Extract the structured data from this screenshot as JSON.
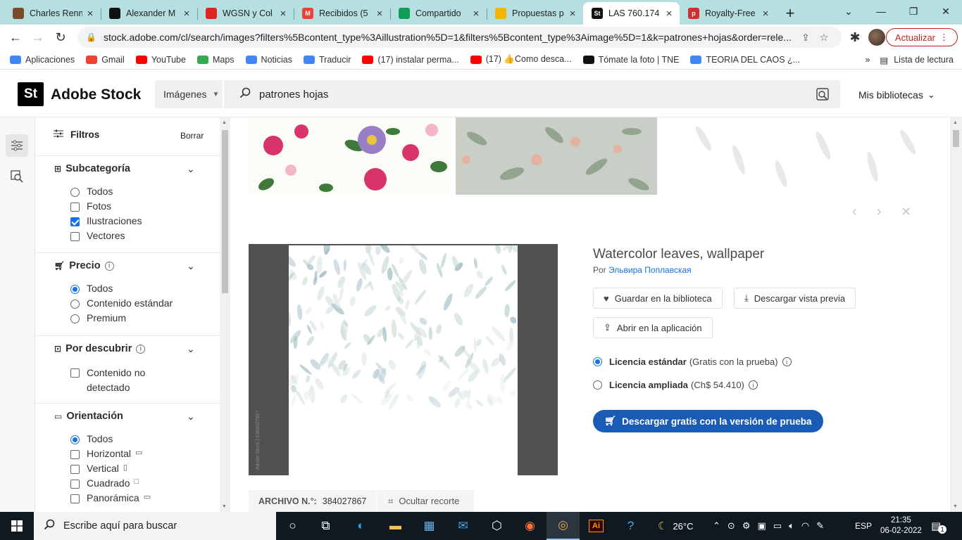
{
  "browser": {
    "tabs": [
      {
        "title": "Charles Renn",
        "fav_text": "",
        "fav_color": "#7a4a2a",
        "active": false
      },
      {
        "title": "Alexander M",
        "fav_text": "",
        "fav_color": "#111111",
        "active": false
      },
      {
        "title": "WGSN y Col",
        "fav_text": "",
        "fav_color": "#e02424",
        "active": false
      },
      {
        "title": "Recibidos (5",
        "fav_text": "M",
        "fav_color": "#ea4335",
        "active": false
      },
      {
        "title": "Compartido",
        "fav_text": "",
        "fav_color": "#0f9d58",
        "active": false
      },
      {
        "title": "Propuestas p",
        "fav_text": "",
        "fav_color": "#f4b400",
        "active": false
      },
      {
        "title": "LAS 760.174",
        "fav_text": "St",
        "fav_color": "#111111",
        "active": true
      },
      {
        "title": "Royalty-Free",
        "fav_text": "p",
        "fav_color": "#d32f2f",
        "active": false
      }
    ],
    "url": "stock.adobe.com/cl/search/images?filters%5Bcontent_type%3Aillustration%5D=1&filters%5Bcontent_type%3Aimage%5D=1&k=patrones+hojas&order=rele...",
    "update_label": "Actualizar",
    "bookmarks": [
      {
        "label": "Aplicaciones",
        "color": "#4285f4"
      },
      {
        "label": "Gmail",
        "color": "#ea4335"
      },
      {
        "label": "YouTube",
        "color": "#ff0000"
      },
      {
        "label": "Maps",
        "color": "#34a853"
      },
      {
        "label": "Noticias",
        "color": "#4285f4"
      },
      {
        "label": "Traducir",
        "color": "#4285f4"
      },
      {
        "label": "(17) instalar perma...",
        "color": "#ff0000"
      },
      {
        "label": "(17) 👍Como desca...",
        "color": "#ff0000"
      },
      {
        "label": "Tómate la foto | TNE",
        "color": "#111111"
      },
      {
        "label": "TEORIA DEL CAOS ¿...",
        "color": "#4285f4"
      }
    ],
    "reading_list": "Lista de lectura"
  },
  "header": {
    "logo_mark": "St",
    "logo_text": "Adobe Stock",
    "type_select": "Imágenes",
    "search_value": "patrones hojas",
    "libraries": "Mis bibliotecas"
  },
  "filters": {
    "title": "Filtros",
    "clear": "Borrar",
    "subcategoria": {
      "title": "Subcategoría",
      "options": [
        "Todos",
        "Fotos",
        "Ilustraciones",
        "Vectores"
      ]
    },
    "precio": {
      "title": "Precio",
      "options": [
        "Todos",
        "Contenido estándar",
        "Premium"
      ]
    },
    "descubrir": {
      "title": "Por descubrir",
      "options": [
        "Contenido no detectado"
      ]
    },
    "orientacion": {
      "title": "Orientación",
      "options": [
        "Todos",
        "Horizontal",
        "Vertical",
        "Cuadrado",
        "Panorámica"
      ]
    }
  },
  "detail": {
    "title": "Watercolor leaves, wallpaper",
    "by_prefix": "Por",
    "author": "Эльвира Поплавская",
    "save_label": "Guardar en la biblioteca",
    "preview_label": "Descargar vista previa",
    "open_app_label": "Abrir en la aplicación",
    "license_std_name": "Licencia estándar",
    "license_std_note": "(Gratis con la prueba)",
    "license_ext_name": "Licencia ampliada",
    "license_ext_note": "(Ch$ 54.410)",
    "cta_label": "Descargar gratis con la versión de prueba",
    "file_label": "ARCHIVO N.°:",
    "file_number": "384027867",
    "crop_label": "Ocultar recorte",
    "watermark": "Adobe Stock | #384027867"
  },
  "taskbar": {
    "search_placeholder": "Escribe aquí para buscar",
    "weather": "26°C",
    "lang": "ESP",
    "time": "21:35",
    "date": "06-02-2022",
    "notifications": "1"
  }
}
